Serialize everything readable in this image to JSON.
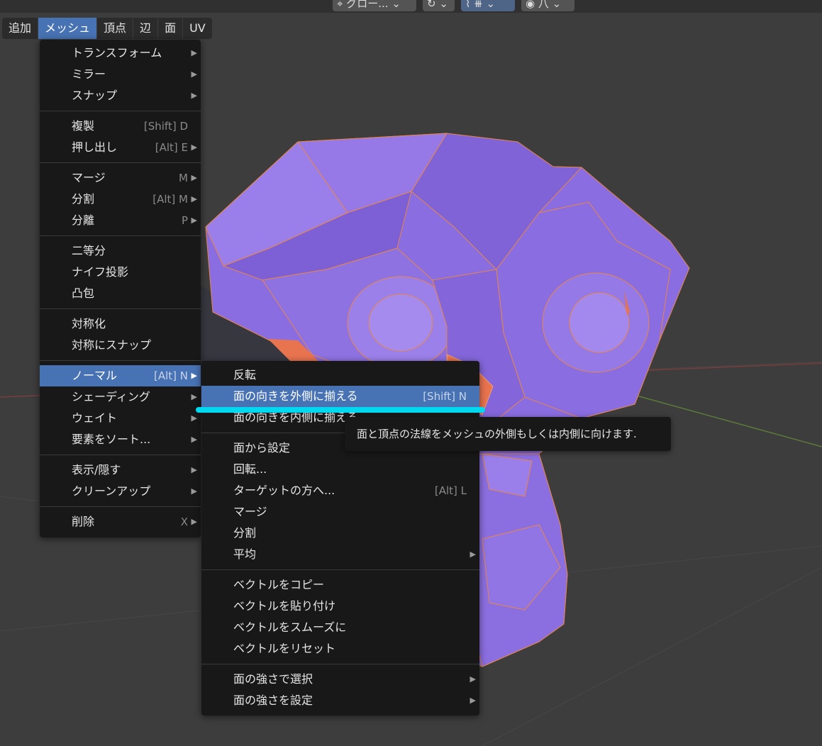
{
  "header": {
    "tools": [
      {
        "label": "グロー...",
        "icon": "transform-orientation-icon"
      },
      {
        "label": "",
        "icon": "pivot-icon"
      },
      {
        "label": "",
        "icon": "snap-icon"
      },
      {
        "label": "八",
        "icon": "proportional-edit-icon"
      }
    ]
  },
  "menubar": {
    "items": [
      "追加",
      "メッシュ",
      "頂点",
      "辺",
      "面",
      "UV"
    ],
    "active": "メッシュ"
  },
  "mesh_menu": {
    "items": [
      {
        "label": "トランスフォーム",
        "shortcut": "",
        "arrow": "▶"
      },
      {
        "label": "ミラー",
        "shortcut": "",
        "arrow": "▶"
      },
      {
        "label": "スナップ",
        "shortcut": "",
        "arrow": "▶"
      },
      {
        "label": "複製",
        "shortcut": "[Shift] D",
        "arrow": ""
      },
      {
        "label": "押し出し",
        "shortcut": "[Alt] E",
        "arrow": "▶"
      },
      {
        "label": "マージ",
        "shortcut": "M",
        "arrow": "▶"
      },
      {
        "label": "分割",
        "shortcut": "[Alt] M",
        "arrow": "▶"
      },
      {
        "label": "分離",
        "shortcut": "P",
        "arrow": "▶"
      },
      {
        "label": "二等分",
        "shortcut": "",
        "arrow": ""
      },
      {
        "label": "ナイフ投影",
        "shortcut": "",
        "arrow": ""
      },
      {
        "label": "凸包",
        "shortcut": "",
        "arrow": ""
      },
      {
        "label": "対称化",
        "shortcut": "",
        "arrow": ""
      },
      {
        "label": "対称にスナップ",
        "shortcut": "",
        "arrow": ""
      },
      {
        "label": "ノーマル",
        "shortcut": "[Alt] N",
        "arrow": "▶"
      },
      {
        "label": "シェーディング",
        "shortcut": "",
        "arrow": "▶"
      },
      {
        "label": "ウェイト",
        "shortcut": "",
        "arrow": "▶"
      },
      {
        "label": "要素をソート...",
        "shortcut": "",
        "arrow": "▶"
      },
      {
        "label": "表示/隠す",
        "shortcut": "",
        "arrow": "▶"
      },
      {
        "label": "クリーンアップ",
        "shortcut": "",
        "arrow": "▶"
      },
      {
        "label": "削除",
        "shortcut": "X",
        "arrow": "▶"
      }
    ],
    "highlighted": "ノーマル"
  },
  "normals_menu": {
    "items": [
      {
        "label": "反転",
        "shortcut": "",
        "arrow": ""
      },
      {
        "label": "面の向きを外側に揃える",
        "shortcut": "[Shift] N",
        "arrow": ""
      },
      {
        "label": "面の向きを内側に揃える",
        "shortcut": "",
        "arrow": ""
      },
      {
        "label": "面から設定",
        "shortcut": "",
        "arrow": ""
      },
      {
        "label": "回転...",
        "shortcut": "",
        "arrow": ""
      },
      {
        "label": "ターゲットの方へ...",
        "shortcut": "[Alt] L",
        "arrow": ""
      },
      {
        "label": "マージ",
        "shortcut": "",
        "arrow": ""
      },
      {
        "label": "分割",
        "shortcut": "",
        "arrow": ""
      },
      {
        "label": "平均",
        "shortcut": "",
        "arrow": "▶"
      },
      {
        "label": "ベクトルをコピー",
        "shortcut": "",
        "arrow": ""
      },
      {
        "label": "ベクトルを貼り付け",
        "shortcut": "",
        "arrow": ""
      },
      {
        "label": "ベクトルをスムーズに",
        "shortcut": "",
        "arrow": ""
      },
      {
        "label": "ベクトルをリセット",
        "shortcut": "",
        "arrow": ""
      },
      {
        "label": "面の強さで選択",
        "shortcut": "",
        "arrow": "▶"
      },
      {
        "label": "面の強さを設定",
        "shortcut": "",
        "arrow": "▶"
      }
    ],
    "highlighted": "面の向きを外側に揃える"
  },
  "tooltip": {
    "text": "面と頂点の法線をメッシュの外側もしくは内側に向けます."
  },
  "colors": {
    "accent": "#4772b3",
    "mesh_face": "#8b6fe0",
    "mesh_edge": "#e8864a",
    "annotation": "#00d8ef"
  }
}
